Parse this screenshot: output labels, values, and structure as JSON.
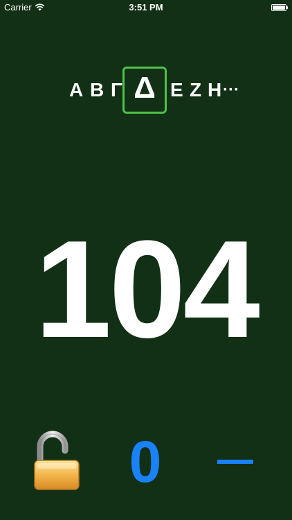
{
  "status_bar": {
    "carrier": "Carrier",
    "time": "3:51 PM",
    "wifi_icon": "wifi-icon",
    "battery_icon": "battery-icon",
    "battery_level": 1.0
  },
  "letter_strip": {
    "letters": [
      "Α",
      "Β",
      "Γ",
      "Δ",
      "Ε",
      "Ζ",
      "Η",
      "···"
    ],
    "selected_index": 3,
    "selected_letter": "Δ",
    "highlight_color": "#4ec24a"
  },
  "counter": {
    "value": "104"
  },
  "bottom_bar": {
    "lock_icon": "unlocked-padlock-icon",
    "score": "0",
    "minus_icon": "minus-icon",
    "accent_color": "#1a82f8"
  },
  "colors": {
    "background": "#123015",
    "text": "#ffffff"
  }
}
